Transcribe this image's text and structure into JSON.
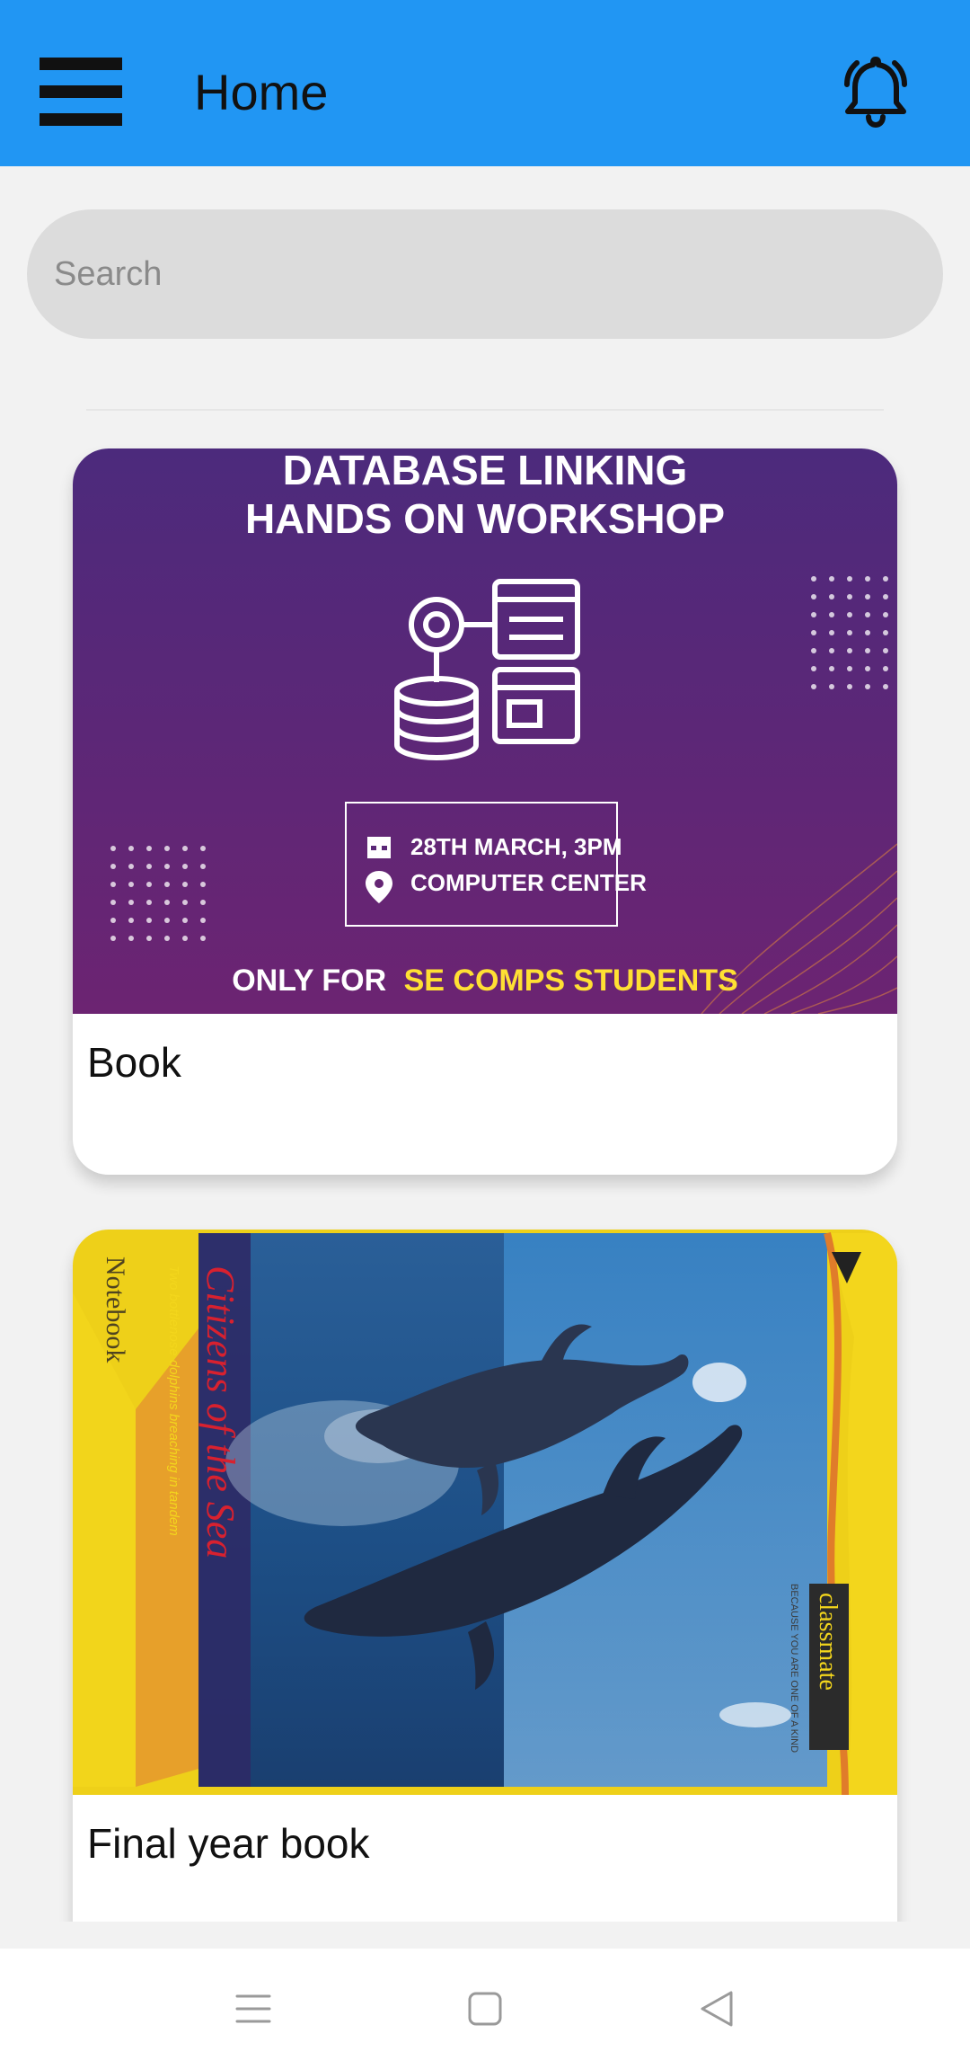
{
  "app_bar": {
    "title": "Home",
    "background": "#2196f3",
    "menu_icon": "hamburger-menu-icon",
    "notification_icon": "bell-icon"
  },
  "search": {
    "placeholder": "Search",
    "value": ""
  },
  "cards": [
    {
      "title": "Book",
      "image": {
        "kind": "workshop-poster",
        "heading_line1": "DATABASE LINKING",
        "heading_line2": "HANDS ON WORKSHOP",
        "date_time": "28TH MARCH, 3PM",
        "location": "COMPUTER CENTER",
        "footer_prefix": "ONLY FOR",
        "footer_highlight": "SE COMPS STUDENTS",
        "colors": {
          "top": "#4c2a7c",
          "bottom": "#6c2472",
          "highlight": "#ffe033"
        }
      }
    },
    {
      "title": "Final year book",
      "image": {
        "kind": "notebook-cover-photo",
        "cover_title": "Citizens of the Sea",
        "cover_subtitle": "Two bottlenose dolphins breaching in tandem",
        "side_label": "Notebook",
        "brand": "classmate",
        "brand_tagline": "BECAUSE YOU ARE ONE OF A KIND",
        "colors": {
          "sea": "#1d4f86",
          "frame": "#f3d61c"
        }
      }
    }
  ],
  "system_nav": {
    "buttons": [
      "recent-apps-icon",
      "home-square-icon",
      "back-triangle-icon"
    ]
  }
}
